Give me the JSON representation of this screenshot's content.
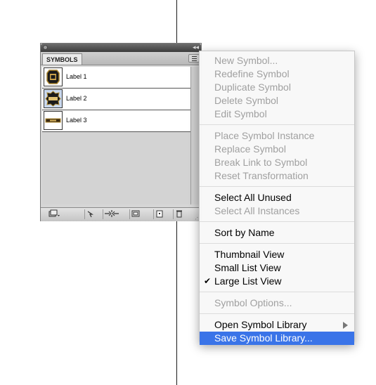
{
  "panel": {
    "tab_label": "SYMBOLS",
    "collapse_glyph": "◂◂",
    "symbols": [
      {
        "label": "Label 1"
      },
      {
        "label": "Label 2"
      },
      {
        "label": "Label 3"
      }
    ],
    "bottom_buttons": [
      {
        "name": "symbol-libraries-button",
        "icon": "library-icon"
      },
      {
        "name": "place-instance-button",
        "icon": "place-icon"
      },
      {
        "name": "break-link-button",
        "icon": "break-link-icon"
      },
      {
        "name": "symbol-options-button",
        "icon": "options-icon"
      },
      {
        "name": "new-symbol-button",
        "icon": "new-icon"
      },
      {
        "name": "delete-symbol-button",
        "icon": "trash-icon"
      }
    ]
  },
  "menu": {
    "sections": [
      [
        {
          "label": "New Symbol...",
          "enabled": false
        },
        {
          "label": "Redefine Symbol",
          "enabled": false
        },
        {
          "label": "Duplicate Symbol",
          "enabled": false
        },
        {
          "label": "Delete Symbol",
          "enabled": false
        },
        {
          "label": "Edit Symbol",
          "enabled": false
        }
      ],
      [
        {
          "label": "Place Symbol Instance",
          "enabled": false
        },
        {
          "label": "Replace Symbol",
          "enabled": false
        },
        {
          "label": "Break Link to Symbol",
          "enabled": false
        },
        {
          "label": "Reset Transformation",
          "enabled": false
        }
      ],
      [
        {
          "label": "Select All Unused",
          "enabled": true
        },
        {
          "label": "Select All Instances",
          "enabled": false
        }
      ],
      [
        {
          "label": "Sort by Name",
          "enabled": true
        }
      ],
      [
        {
          "label": "Thumbnail View",
          "enabled": true
        },
        {
          "label": "Small List View",
          "enabled": true
        },
        {
          "label": "Large List View",
          "enabled": true,
          "checked": true
        }
      ],
      [
        {
          "label": "Symbol Options...",
          "enabled": false
        }
      ],
      [
        {
          "label": "Open Symbol Library",
          "enabled": true,
          "submenu": true
        },
        {
          "label": "Save Symbol Library...",
          "enabled": true,
          "highlighted": true
        }
      ]
    ],
    "check_glyph": "✔",
    "highlight_color": "#3a74e8",
    "disabled_color": "#a0a0a0"
  }
}
